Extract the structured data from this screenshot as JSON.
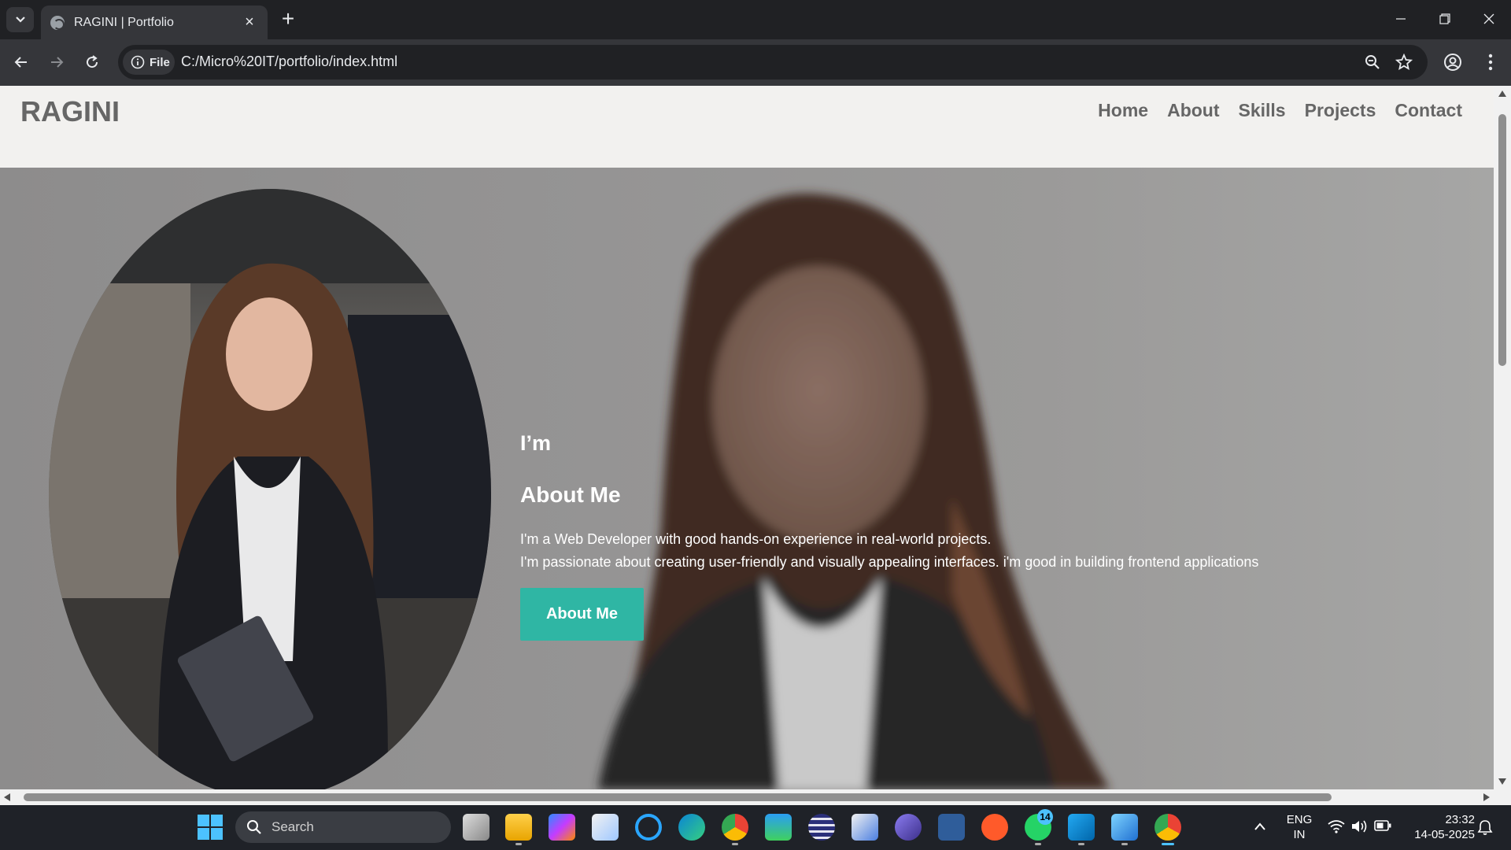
{
  "browser": {
    "tab_title": "RAGINI | Portfolio",
    "new_tab_symbol": "+",
    "site_info_label": "File",
    "url": "C:/Micro%20IT/portfolio/index.html"
  },
  "site": {
    "logo": "RAGINI",
    "nav": [
      "Home",
      "About",
      "Skills",
      "Projects",
      "Contact"
    ],
    "hero": {
      "intro": "I’m",
      "title": "About Me",
      "desc_line1": "I'm a Web Developer with good hands-on experience in real-world projects.",
      "desc_line2": "I'm passionate about creating user-friendly and visually appealing interfaces. i'm good in building frontend applications",
      "button": "About Me",
      "button_color": "#2fb6a4"
    }
  },
  "taskbar": {
    "search_label": "Search",
    "whatsapp_badge": "14",
    "lang_line1": "ENG",
    "lang_line2": "IN",
    "time": "23:32",
    "date": "14-05-2025"
  }
}
